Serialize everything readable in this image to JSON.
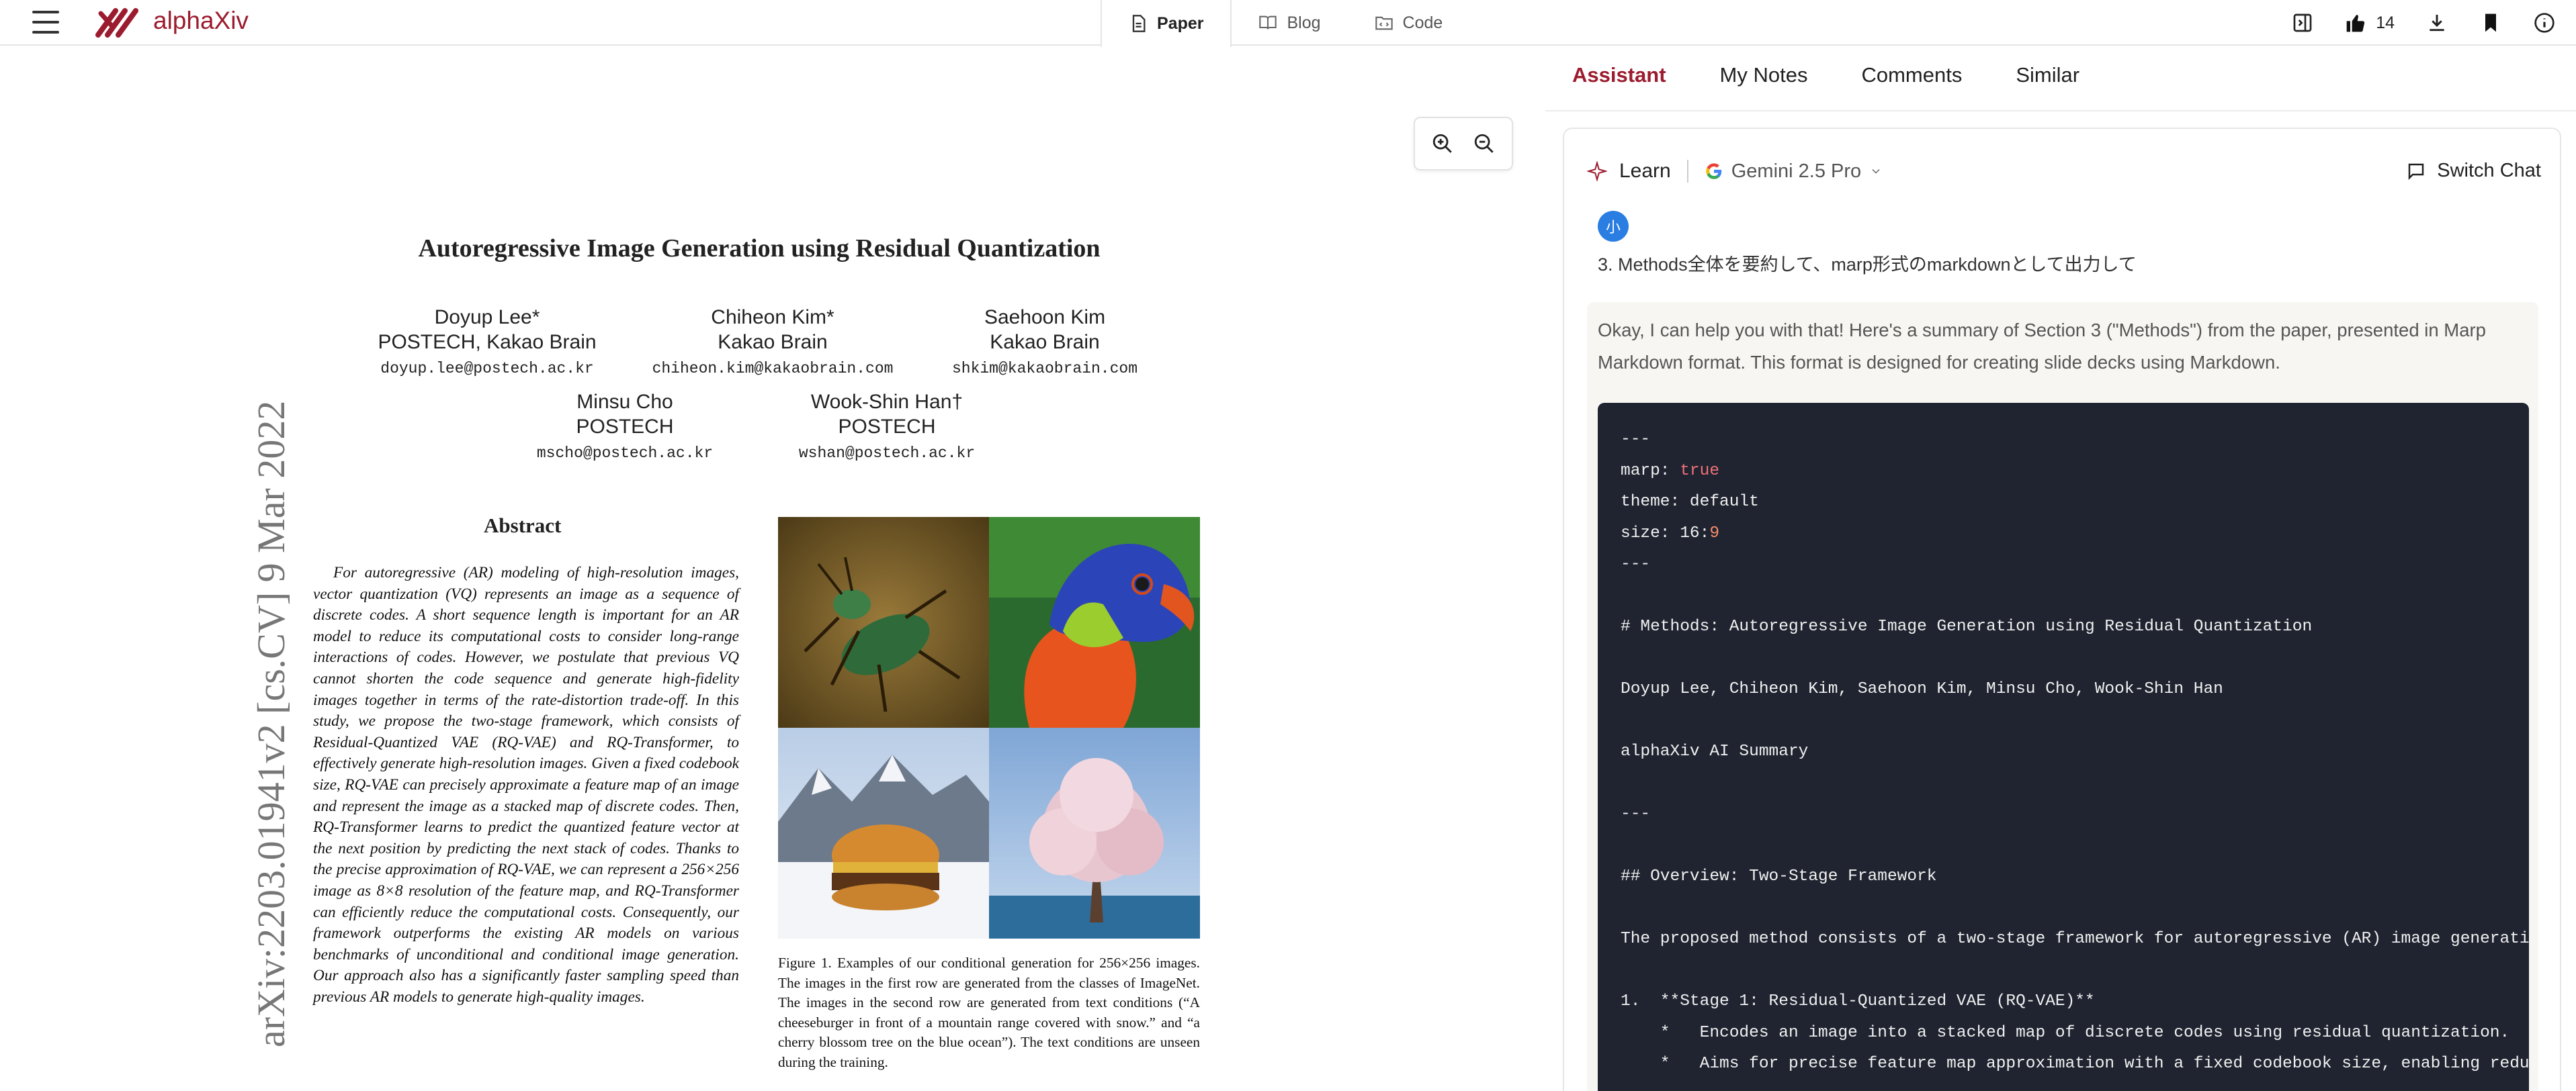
{
  "app": {
    "name": "alphaXiv"
  },
  "tabs": [
    {
      "label": "Paper",
      "icon": "document-icon",
      "active": true
    },
    {
      "label": "Blog",
      "icon": "book-icon",
      "active": false
    },
    {
      "label": "Code",
      "icon": "folder-code-icon",
      "active": false
    }
  ],
  "toolbar": {
    "likes_count": "14"
  },
  "paper": {
    "title": "Autoregressive Image Generation using Residual Quantization",
    "authors": [
      {
        "name": "Doyup Lee*",
        "affiliation": "POSTECH, Kakao Brain",
        "email": "doyup.lee@postech.ac.kr"
      },
      {
        "name": "Chiheon Kim*",
        "affiliation": "Kakao Brain",
        "email": "chiheon.kim@kakaobrain.com"
      },
      {
        "name": "Saehoon Kim",
        "affiliation": "Kakao Brain",
        "email": "shkim@kakaobrain.com"
      },
      {
        "name": "Minsu Cho",
        "affiliation": "POSTECH",
        "email": "mscho@postech.ac.kr"
      },
      {
        "name": "Wook-Shin Han†",
        "affiliation": "POSTECH",
        "email": "wshan@postech.ac.kr"
      }
    ],
    "arxiv_id": "arXiv:2203.01941v2  [cs.CV]  9 Mar 2022",
    "abstract_title": "Abstract",
    "abstract": "For autoregressive (AR) modeling of high-resolution images, vector quantization (VQ) represents an image as a sequence of discrete codes. A short sequence length is important for an AR model to reduce its computational costs to consider long-range interactions of codes. However, we postulate that previous VQ cannot shorten the code sequence and generate high-fidelity images together in terms of the rate-distortion trade-off. In this study, we propose the two-stage framework, which consists of Residual-Quantized VAE (RQ-VAE) and RQ-Transformer, to effectively generate high-resolution images. Given a fixed codebook size, RQ-VAE can precisely approximate a feature map of an image and represent the image as a stacked map of discrete codes. Then, RQ-Transformer learns to predict the quantized feature vector at the next position by predicting the next stack of codes. Thanks to the precise approximation of RQ-VAE, we can represent a 256×256 image as 8×8 resolution of the feature map, and RQ-Transformer can efficiently reduce the computational costs. Consequently, our framework outperforms the existing AR models on various benchmarks of unconditional and conditional image generation. Our approach also has a significantly faster sampling speed than previous AR models to generate high-quality images.",
    "figure_caption": "Figure 1.  Examples of our conditional generation for 256×256 images. The images in the first row are generated from the classes of ImageNet. The images in the second row are generated from text conditions (“A cheeseburger in front of a mountain range covered with snow.” and “a cherry blossom tree on the blue ocean”). The text conditions are unseen during the training."
  },
  "side_panel": {
    "tabs": [
      {
        "label": "Assistant",
        "active": true
      },
      {
        "label": "My Notes",
        "active": false
      },
      {
        "label": "Comments",
        "active": false
      },
      {
        "label": "Similar",
        "active": false
      }
    ],
    "chat": {
      "mode_label": "Learn",
      "model_label": "Gemini 2.5 Pro",
      "switch_label": "Switch Chat",
      "user_avatar": "小",
      "user_message": "3. Methods全体を要約して、marp形式のmarkdownとして出力して",
      "assistant_intro": "Okay, I can help you with that! Here's a summary of Section 3 (\"Methods\") from the paper, presented in Marp Markdown format. This format is designed for creating slide decks using Markdown.",
      "code_lines": [
        "---",
        "marp: true",
        "theme: default",
        "size: 16:9",
        "---",
        "",
        "# Methods: Autoregressive Image Generation using Residual Quantization",
        "",
        "Doyup Lee, Chiheon Kim, Saehoon Kim, Minsu Cho, Wook-Shin Han",
        "",
        "alphaXiv AI Summary",
        "",
        "---",
        "",
        "## Overview: Two-Stage Framework",
        "",
        "The proposed method consists of a two-stage framework for autoregressive (AR) image generation",
        "",
        "1.  **Stage 1: Residual-Quantized VAE (RQ-VAE)**",
        "    *   Encodes an image into a stacked map of discrete codes using residual quantization.",
        "    *   Aims for precise feature map approximation with a fixed codebook size, enabling reduce"
      ]
    }
  },
  "colors": {
    "brand": "#9b1c2e",
    "code_bg": "#1f2430",
    "avatar": "#2a7de1"
  }
}
